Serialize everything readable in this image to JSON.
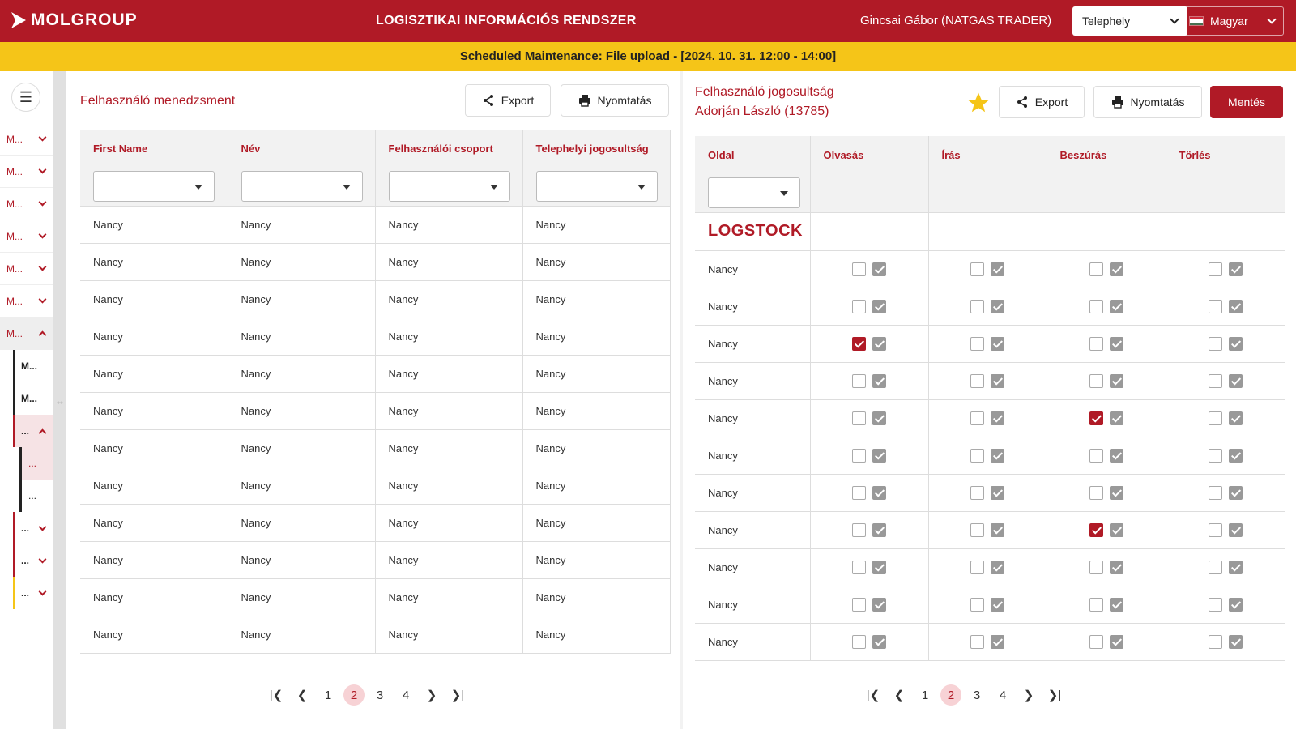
{
  "header": {
    "brand": "MOLGROUP",
    "app_title": "LOGISZTIKAI INFORMÁCIÓS RENDSZER",
    "user": "Gincsai Gábor (NATGAS TRADER)",
    "site_select": "Telephely",
    "language": "Magyar",
    "colors": {
      "primary": "#b01a26",
      "banner": "#f5c518"
    }
  },
  "banner": {
    "text": "Scheduled Maintenance: File upload - [2024. 10. 31. 12:00 - 14:00]"
  },
  "sidebar": {
    "menu_icon": "hamburger-icon",
    "items": [
      {
        "label": "M..."
      },
      {
        "label": "M..."
      },
      {
        "label": "M..."
      },
      {
        "label": "M..."
      },
      {
        "label": "M..."
      },
      {
        "label": "M..."
      },
      {
        "label": "M..."
      }
    ],
    "subitems": [
      {
        "label": "M..."
      },
      {
        "label": "M..."
      },
      {
        "label": "..."
      },
      {
        "label": "..."
      },
      {
        "label": "..."
      },
      {
        "label": "..."
      },
      {
        "label": "..."
      },
      {
        "label": "..."
      }
    ]
  },
  "left": {
    "title": "Felhasználó menedzsment",
    "export": "Export",
    "print": "Nyomtatás",
    "columns": [
      "First Name",
      "Név",
      "Felhasználói csoport",
      "Telephelyi jogosultság"
    ],
    "rows": [
      [
        "Nancy",
        "Nancy",
        "Nancy",
        "Nancy"
      ],
      [
        "Nancy",
        "Nancy",
        "Nancy",
        "Nancy"
      ],
      [
        "Nancy",
        "Nancy",
        "Nancy",
        "Nancy"
      ],
      [
        "Nancy",
        "Nancy",
        "Nancy",
        "Nancy"
      ],
      [
        "Nancy",
        "Nancy",
        "Nancy",
        "Nancy"
      ],
      [
        "Nancy",
        "Nancy",
        "Nancy",
        "Nancy"
      ],
      [
        "Nancy",
        "Nancy",
        "Nancy",
        "Nancy"
      ],
      [
        "Nancy",
        "Nancy",
        "Nancy",
        "Nancy"
      ],
      [
        "Nancy",
        "Nancy",
        "Nancy",
        "Nancy"
      ],
      [
        "Nancy",
        "Nancy",
        "Nancy",
        "Nancy"
      ],
      [
        "Nancy",
        "Nancy",
        "Nancy",
        "Nancy"
      ],
      [
        "Nancy",
        "Nancy",
        "Nancy",
        "Nancy"
      ]
    ],
    "pager": {
      "pages": [
        "1",
        "2",
        "3",
        "4"
      ],
      "current": "2"
    }
  },
  "right": {
    "title_line1": "Felhasználó jogosultság",
    "title_line2": "Adorján László (13785)",
    "export": "Export",
    "print": "Nyomtatás",
    "save": "Mentés",
    "columns": [
      "Oldal",
      "Olvasás",
      "Írás",
      "Beszúrás",
      "Törlés"
    ],
    "group": "LOGSTOCK",
    "rows": [
      {
        "name": "Nancy",
        "checked": [
          false,
          false,
          false,
          false
        ]
      },
      {
        "name": "Nancy",
        "checked": [
          false,
          false,
          false,
          false
        ]
      },
      {
        "name": "Nancy",
        "checked": [
          true,
          false,
          false,
          false
        ]
      },
      {
        "name": "Nancy",
        "checked": [
          false,
          false,
          false,
          false
        ]
      },
      {
        "name": "Nancy",
        "checked": [
          false,
          false,
          true,
          false
        ]
      },
      {
        "name": "Nancy",
        "checked": [
          false,
          false,
          false,
          false
        ]
      },
      {
        "name": "Nancy",
        "checked": [
          false,
          false,
          false,
          false
        ]
      },
      {
        "name": "Nancy",
        "checked": [
          false,
          false,
          true,
          false
        ]
      },
      {
        "name": "Nancy",
        "checked": [
          false,
          false,
          false,
          false
        ]
      },
      {
        "name": "Nancy",
        "checked": [
          false,
          false,
          false,
          false
        ]
      },
      {
        "name": "Nancy",
        "checked": [
          false,
          false,
          false,
          false
        ]
      }
    ],
    "pager": {
      "pages": [
        "1",
        "2",
        "3",
        "4"
      ],
      "current": "2"
    }
  }
}
